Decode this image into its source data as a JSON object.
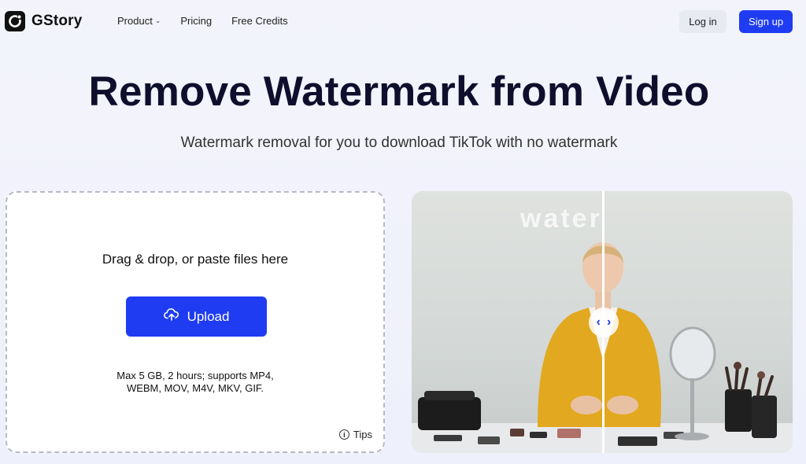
{
  "header": {
    "logo_text": "GStory",
    "nav": [
      {
        "label": "Product",
        "has_dropdown": true
      },
      {
        "label": "Pricing"
      },
      {
        "label": "Free Credits"
      }
    ],
    "login_label": "Log in",
    "signup_label": "Sign up"
  },
  "hero": {
    "title": "Remove Watermark from Video",
    "subtitle": "Watermark removal for you to download TikTok with no watermark"
  },
  "upload": {
    "drop_text": "Drag & drop, or paste files here",
    "button_label": "Upload",
    "limits_line1": "Max 5 GB, 2 hours; supports MP4,",
    "limits_line2": "WEBM, MOV, M4V, MKV, GIF.",
    "tips_label": "Tips",
    "tips_icon_glyph": "i"
  },
  "preview": {
    "watermark_text": "water",
    "handle_left": "‹",
    "handle_right": "›"
  },
  "colors": {
    "accent": "#1f3cf2",
    "title": "#0f0f2d"
  }
}
